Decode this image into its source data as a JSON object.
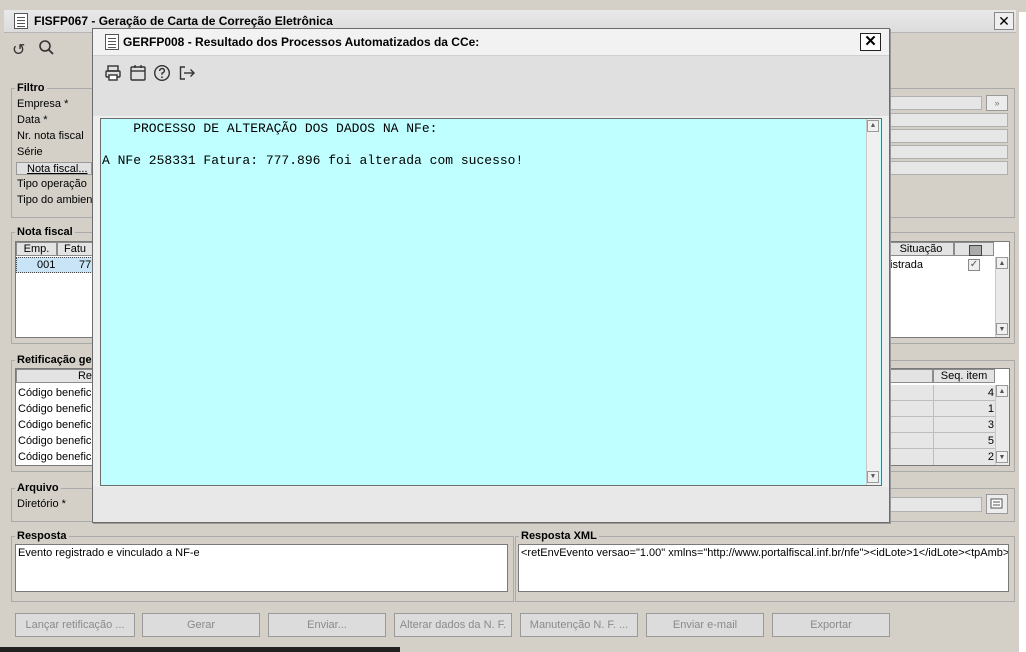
{
  "main": {
    "title": "FISFP067 - Geração de Carta de Correção Eletrônica",
    "toolbar": {
      "refresh_icon": "refresh-icon",
      "search_icon": "search-icon"
    },
    "filtro": {
      "legend": "Filtro",
      "labels": [
        "Empresa *",
        "Data *",
        "Nr. nota fiscal",
        "Série",
        "Nota fiscal...",
        "Tipo operação",
        "Tipo do ambient"
      ]
    },
    "nota_fiscal": {
      "legend": "Nota fiscal",
      "col_emp": "Emp.",
      "col_fatura": "Fatu",
      "col_situacao": "Situação",
      "row": {
        "emp": "001",
        "fatura": "77",
        "situacao": "istrada"
      }
    },
    "retificacao": {
      "legend": "Retificação ge",
      "col_re": "Re",
      "col_seq": "Seq. item",
      "rows": [
        {
          "label": "Código benefic",
          "seq": "4"
        },
        {
          "label": "Código benefic",
          "seq": "1"
        },
        {
          "label": "Código benefic",
          "seq": "3"
        },
        {
          "label": "Código benefic",
          "seq": "5"
        },
        {
          "label": "Código benefic",
          "seq": "2"
        }
      ]
    },
    "arquivo": {
      "legend": "Arquivo",
      "diretorio_label": "Diretório *"
    },
    "resposta": {
      "legend": "Resposta",
      "text": "Evento registrado e vinculado a NF-e"
    },
    "resposta_xml": {
      "legend": "Resposta XML",
      "text": "<retEnvEvento versao=\"1.00\" xmlns=\"http://www.portalfiscal.inf.br/nfe\"><idLote>1</idLote><tpAmb>"
    },
    "buttons": {
      "lancar": "Lançar retificação ...",
      "gerar": "Gerar",
      "enviar": "Enviar...",
      "alterar": "Alterar dados da N. F.",
      "manutencao": "Manutenção N. F. ...",
      "email": "Enviar e-mail",
      "exportar": "Exportar"
    }
  },
  "dialog": {
    "title": "GERFP008 - Resultado dos Processos Automatizados da CCe:",
    "close_label": "✕",
    "toolbar_icons": [
      "print-icon",
      "calendar-icon",
      "help-icon",
      "exit-icon"
    ],
    "content": {
      "heading": "    PROCESSO DE ALTERAÇÃO DOS DADOS NA NFe:",
      "message": "A NFe 258331 Fatura: 777.896 foi alterada com sucesso!"
    }
  },
  "colors": {
    "text_area_bg": "#c0ffff",
    "window_bg": "#d4d0c8"
  }
}
